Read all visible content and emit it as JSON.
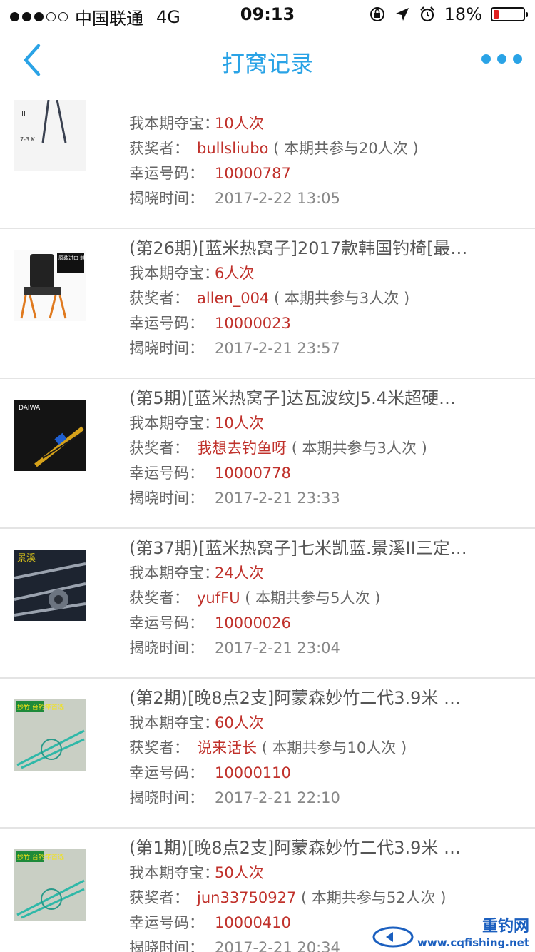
{
  "status_bar": {
    "carrier": "中国联通",
    "network": "4G",
    "time": "09:13",
    "battery": "18%",
    "battery_level": 0.18
  },
  "nav": {
    "title": "打窝记录"
  },
  "labels": {
    "my_entries": "我本期夺宝：",
    "winner": "获奖者：",
    "lucky": "幸运号码：",
    "reveal": "揭晓时间："
  },
  "records": [
    {
      "title": "",
      "my_entries": "10人次",
      "winner": "bullsliubo",
      "total": "( 本期共参与20人次 )",
      "lucky_number": "10000787",
      "reveal_time": "2017-2-22 13:05"
    },
    {
      "title": "(第26期)[蓝米热窝子]2017款韩国钓椅[最…",
      "my_entries": "6人次",
      "winner": "allen_004",
      "total": "( 本期共参与3人次 )",
      "lucky_number": "10000023",
      "reveal_time": "2017-2-21 23:57"
    },
    {
      "title": "(第5期)[蓝米热窝子]达瓦波纹J5.4米超硬…",
      "my_entries": "10人次",
      "winner": "我想去钓鱼呀",
      "total": "( 本期共参与3人次 )",
      "lucky_number": "10000778",
      "reveal_time": "2017-2-21 23:33"
    },
    {
      "title": "(第37期)[蓝米热窝子]七米凯蓝.景溪II三定…",
      "my_entries": "24人次",
      "winner": "yufFU",
      "total": "( 本期共参与5人次 )",
      "lucky_number": "10000026",
      "reveal_time": "2017-2-21 23:04"
    },
    {
      "title": "(第2期)[晚8点2支]阿蒙森妙竹二代3.9米 …",
      "my_entries": "60人次",
      "winner": "说来话长",
      "total": "( 本期共参与10人次 )",
      "lucky_number": "10000110",
      "reveal_time": "2017-2-21 22:10"
    },
    {
      "title": "(第1期)[晚8点2支]阿蒙森妙竹二代3.9米 …",
      "my_entries": "50人次",
      "winner": "jun33750927",
      "total": "( 本期共参与52人次 )",
      "lucky_number": "10000410",
      "reveal_time": "2017-2-21 20:34"
    }
  ],
  "thumbs": [
    {
      "icon": "fishing-rod-image"
    },
    {
      "icon": "fishing-chair-image",
      "text": "原装进口 韩国钓椅"
    },
    {
      "icon": "daiwa-rod-image",
      "text": "DAIWA"
    },
    {
      "icon": "rod-reel-image",
      "text": "景溪"
    },
    {
      "icon": "green-rod-image",
      "text": "妙竹 台钓竿首选"
    },
    {
      "icon": "green-rod-image",
      "text": "妙竹 台钓竿首选"
    }
  ],
  "watermark": {
    "brand": "重钓网",
    "url": "www.cqfishing.net"
  }
}
